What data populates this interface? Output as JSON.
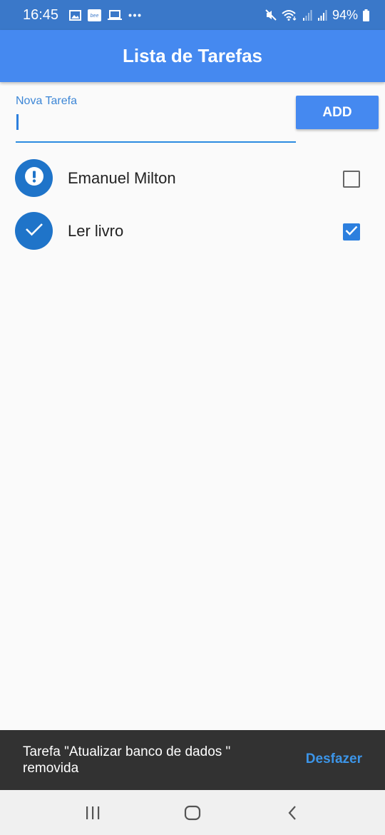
{
  "status_bar": {
    "time": "16:45",
    "left_icons": [
      "image-icon",
      "bee-app-icon",
      "laptop-icon",
      "more-dots-icon"
    ],
    "right_icons": [
      "mute-icon",
      "wifi-icon",
      "signal-icon",
      "signal-icon",
      "battery-icon"
    ],
    "battery": "94%"
  },
  "app_bar": {
    "title": "Lista de Tarefas"
  },
  "new_task": {
    "label": "Nova Tarefa",
    "value": "",
    "add_label": "ADD"
  },
  "tasks": [
    {
      "title": "Emanuel Milton",
      "done": false,
      "avatar_icon": "alert-icon"
    },
    {
      "title": "Ler livro",
      "done": true,
      "avatar_icon": "check-icon"
    }
  ],
  "snackbar": {
    "message": "Tarefa \"Atualizar banco de dados \" removida",
    "action": "Desfazer"
  },
  "colors": {
    "primary": "#4589f0",
    "status_bar": "#3a78c9",
    "avatar": "#1f74c9",
    "accent": "#2c7fde",
    "snackbar": "#323232",
    "snackbar_action": "#3c95e8"
  },
  "nav_bar": {
    "icons": [
      "recents-icon",
      "home-icon",
      "back-icon"
    ]
  }
}
